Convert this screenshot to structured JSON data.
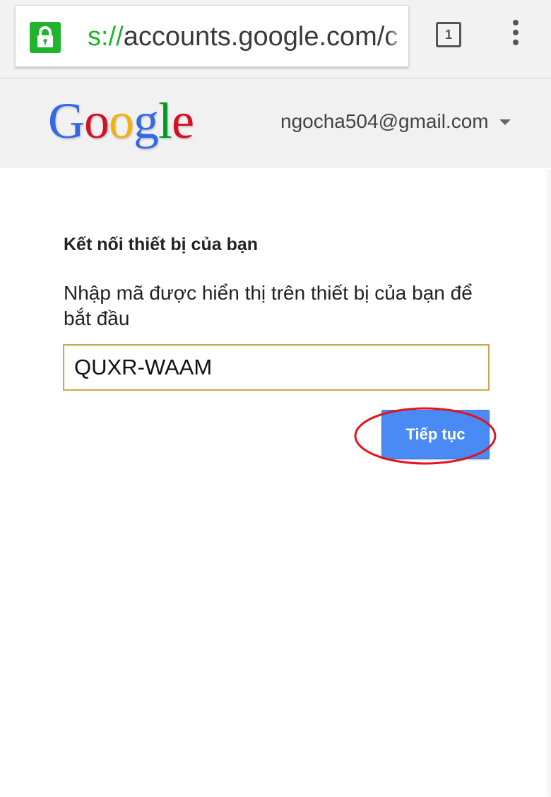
{
  "browser": {
    "url_scheme": "s://",
    "url_host": "accounts.google.com/",
    "url_trailing": "c",
    "tab_count": "1",
    "lock_color": "#1fb42b",
    "icons": [
      "lock-icon",
      "tabs-icon",
      "more-vert-icon"
    ]
  },
  "header": {
    "logo_letters": [
      "G",
      "o",
      "o",
      "g",
      "l",
      "e"
    ],
    "logo_colors": [
      "#3369e8",
      "#d50f25",
      "#eeb211",
      "#3369e8",
      "#009925",
      "#d50f25"
    ],
    "account_email": "ngocha504@gmail.com"
  },
  "main": {
    "title": "Kết nối thiết bị của bạn",
    "instruction": "Nhập mã được hiển thị trên thiết bị của bạn để bắt đầu",
    "code_value": "QUXR-WAAM",
    "continue_label": "Tiếp tục",
    "button_color": "#4a8af4",
    "highlight_color": "#e3141c"
  }
}
